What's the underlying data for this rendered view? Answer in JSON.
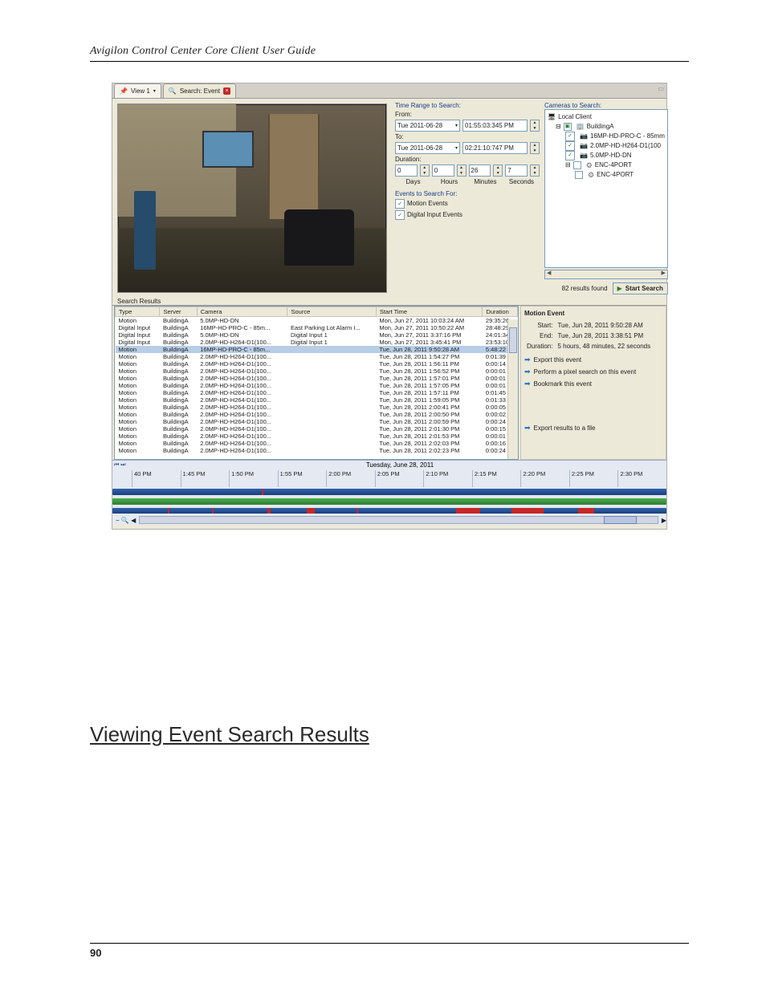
{
  "doc": {
    "running_head": "Avigilon Control Center Core Client User Guide",
    "section_heading": "Viewing Event Search Results",
    "page_number": "90"
  },
  "tabs": {
    "view": "View 1",
    "search": "Search: Event"
  },
  "search": {
    "time_range_label": "Time Range to Search:",
    "from_label": "From:",
    "from_date": "Tue 2011-06-28",
    "from_time": "01:55:03:345 PM",
    "to_label": "To:",
    "to_date": "Tue 2011-06-28",
    "to_time": "02:21:10:747 PM",
    "duration_label": "Duration:",
    "dur_days": "0",
    "dur_hours": "0",
    "dur_min": "26",
    "dur_sec": "7",
    "days": "Days",
    "hours": "Hours",
    "minutes": "Minutes",
    "seconds": "Seconds",
    "events_label": "Events to Search For:",
    "ev_motion": "Motion Events",
    "ev_digital": "Digital Input Events"
  },
  "cameras": {
    "label": "Cameras to Search:",
    "root": "Local Client",
    "site": "BuildingA",
    "c1": "16MP-HD-PRO-C - 85mm",
    "c2": "2.0MP-HD-H264-D1(100",
    "c3": "5.0MP-HD-DN",
    "enc": "ENC-4PORT",
    "enc_child": "ENC-4PORT",
    "results_found": "82 results found",
    "start_search": "Start Search"
  },
  "results": {
    "label": "Search Results",
    "cols": {
      "type": "Type",
      "server": "Server",
      "camera": "Camera",
      "source": "Source",
      "start": "Start Time",
      "dur": "Duration"
    },
    "rows": [
      {
        "t": "Motion",
        "s": "BuildingA",
        "c": "5.0MP-HD-DN",
        "src": "",
        "st": "Mon, Jun 27, 2011 10:03:24 AM",
        "d": "29:35:26"
      },
      {
        "t": "Digital Input",
        "s": "BuildingA",
        "c": "16MP-HD-PRO-C - 85m...",
        "src": "East Parking Lot Alarm I...",
        "st": "Mon, Jun 27, 2011 10:50:22 AM",
        "d": "28:48:29"
      },
      {
        "t": "Digital Input",
        "s": "BuildingA",
        "c": "5.0MP-HD-DN",
        "src": "Digital Input 1",
        "st": "Mon, Jun 27, 2011 3:37:16 PM",
        "d": "24:01:34"
      },
      {
        "t": "Digital Input",
        "s": "BuildingA",
        "c": "2.0MP-HD-H264-D1(100...",
        "src": "Digital Input 1",
        "st": "Mon, Jun 27, 2011 3:45:41 PM",
        "d": "23:53:10"
      },
      {
        "t": "Motion",
        "s": "BuildingA",
        "c": "16MP-HD-PRO-C - 85m...",
        "src": "",
        "st": "Tue, Jun 28, 2011 9:50:28 AM",
        "d": "5:48:22",
        "sel": true
      },
      {
        "t": "Motion",
        "s": "BuildingA",
        "c": "2.0MP-HD-H264-D1(100...",
        "src": "",
        "st": "Tue, Jun 28, 2011 1:54:27 PM",
        "d": "0:01:39"
      },
      {
        "t": "Motion",
        "s": "BuildingA",
        "c": "2.0MP-HD-H264-D1(100...",
        "src": "",
        "st": "Tue, Jun 28, 2011 1:56:11 PM",
        "d": "0:00:14"
      },
      {
        "t": "Motion",
        "s": "BuildingA",
        "c": "2.0MP-HD-H264-D1(100...",
        "src": "",
        "st": "Tue, Jun 28, 2011 1:56:52 PM",
        "d": "0:00:01"
      },
      {
        "t": "Motion",
        "s": "BuildingA",
        "c": "2.0MP-HD-H264-D1(100...",
        "src": "",
        "st": "Tue, Jun 28, 2011 1:57:01 PM",
        "d": "0:00:01"
      },
      {
        "t": "Motion",
        "s": "BuildingA",
        "c": "2.0MP-HD-H264-D1(100...",
        "src": "",
        "st": "Tue, Jun 28, 2011 1:57:05 PM",
        "d": "0:00:01"
      },
      {
        "t": "Motion",
        "s": "BuildingA",
        "c": "2.0MP-HD-H264-D1(100...",
        "src": "",
        "st": "Tue, Jun 28, 2011 1:57:11 PM",
        "d": "0:01:45"
      },
      {
        "t": "Motion",
        "s": "BuildingA",
        "c": "2.0MP-HD-H264-D1(100...",
        "src": "",
        "st": "Tue, Jun 28, 2011 1:59:05 PM",
        "d": "0:01:33"
      },
      {
        "t": "Motion",
        "s": "BuildingA",
        "c": "2.0MP-HD-H264-D1(100...",
        "src": "",
        "st": "Tue, Jun 28, 2011 2:00:41 PM",
        "d": "0:00:05"
      },
      {
        "t": "Motion",
        "s": "BuildingA",
        "c": "2.0MP-HD-H264-D1(100...",
        "src": "",
        "st": "Tue, Jun 28, 2011 2:00:50 PM",
        "d": "0:00:02"
      },
      {
        "t": "Motion",
        "s": "BuildingA",
        "c": "2.0MP-HD-H264-D1(100...",
        "src": "",
        "st": "Tue, Jun 28, 2011 2:00:59 PM",
        "d": "0:00:24"
      },
      {
        "t": "Motion",
        "s": "BuildingA",
        "c": "2.0MP-HD-H264-D1(100...",
        "src": "",
        "st": "Tue, Jun 28, 2011 2:01:30 PM",
        "d": "0:00:15"
      },
      {
        "t": "Motion",
        "s": "BuildingA",
        "c": "2.0MP-HD-H264-D1(100...",
        "src": "",
        "st": "Tue, Jun 28, 2011 2:01:53 PM",
        "d": "0:00:01"
      },
      {
        "t": "Motion",
        "s": "BuildingA",
        "c": "2.0MP-HD-H264-D1(100...",
        "src": "",
        "st": "Tue, Jun 28, 2011 2:02:03 PM",
        "d": "0:00:16"
      },
      {
        "t": "Motion",
        "s": "BuildingA",
        "c": "2.0MP-HD-H264-D1(100...",
        "src": "",
        "st": "Tue, Jun 28, 2011 2:02:23 PM",
        "d": "0:00:24"
      }
    ]
  },
  "detail": {
    "title": "Motion Event",
    "start_l": "Start:",
    "start_v": "Tue, Jun 28, 2011 9:50:28 AM",
    "end_l": "End:",
    "end_v": "Tue, Jun 28, 2011 3:38:51 PM",
    "dur_l": "Duration:",
    "dur_v": "5 hours, 48 minutes, 22 seconds",
    "a1": "Export this event",
    "a2": "Perform a pixel search on this event",
    "a3": "Bookmark this event",
    "a4": "Export results to a file"
  },
  "timeline": {
    "date": "Tuesday, June 28, 2011",
    "ticks": [
      "40 PM",
      "1:45 PM",
      "1:50 PM",
      "1:55 PM",
      "2:00 PM",
      "2:05 PM",
      "2:10 PM",
      "2:15 PM",
      "2:20 PM",
      "2:25 PM",
      "2:30 PM"
    ]
  }
}
